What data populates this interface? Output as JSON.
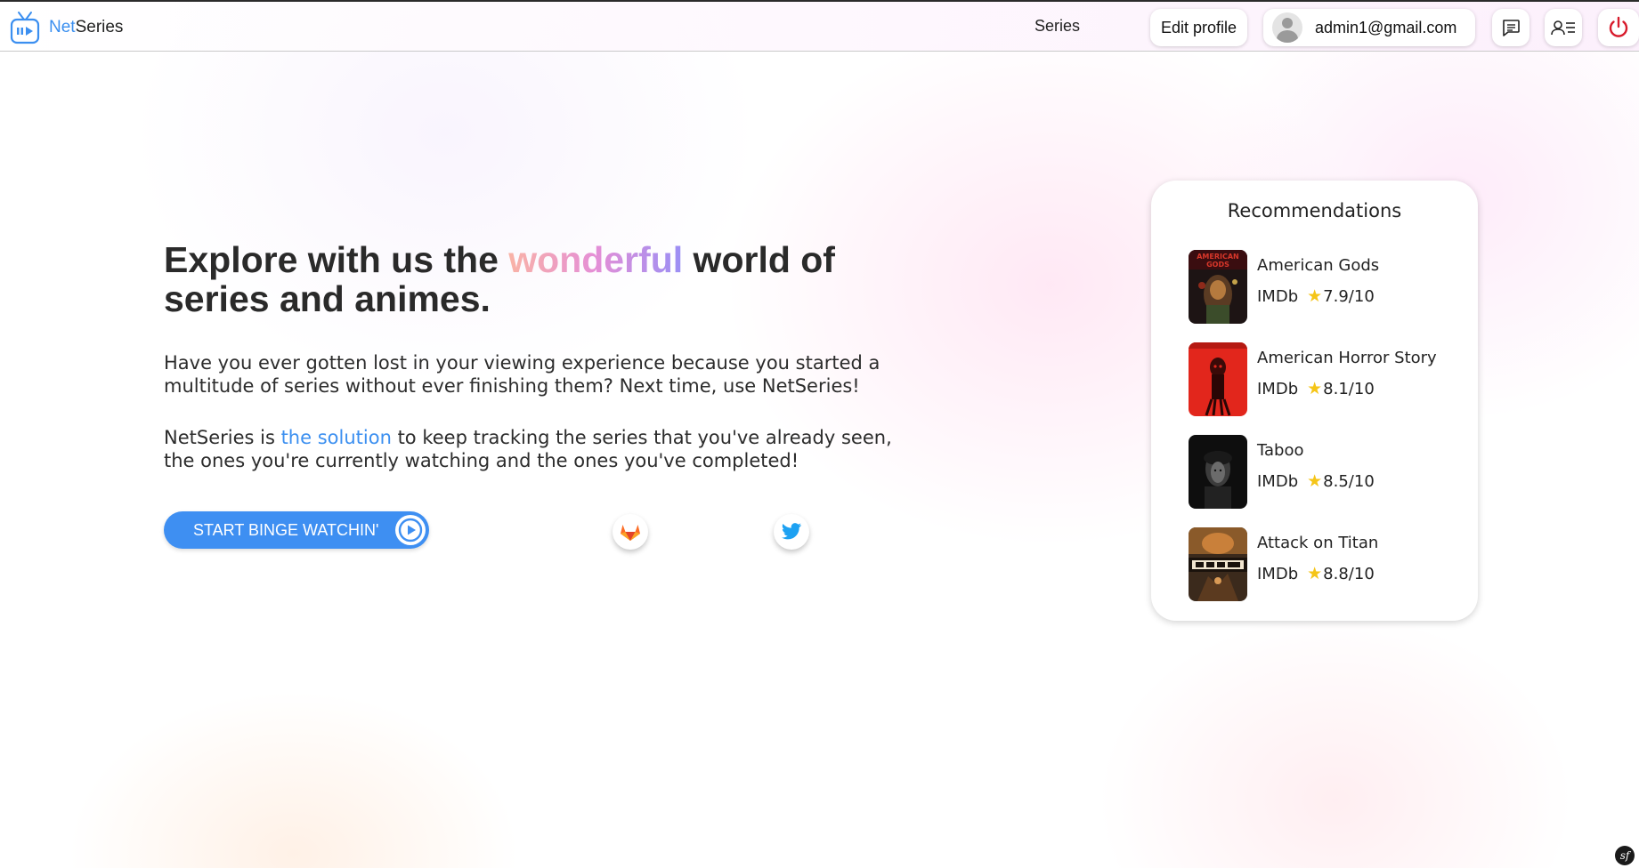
{
  "navbar": {
    "brand_prefix": "Net",
    "brand_suffix": "Series",
    "nav_series": "Series",
    "edit_profile": "Edit profile",
    "user_email": "admin1@gmail.com"
  },
  "hero": {
    "title_before": "Explore with us the ",
    "title_highlight": "wonderful",
    "title_after": " world of series and animes.",
    "paragraph1": "Have you ever gotten lost in your viewing experience because you started a multitude of series without ever finishing them? Next time, use NetSeries!",
    "paragraph2_before": "NetSeries is ",
    "paragraph2_highlight": "the solution",
    "paragraph2_after": " to keep tracking the series that you've already seen, the ones you're currently watching and the ones you've completed!",
    "cta_label": "START BINGE WATCHIN'"
  },
  "recommendations": {
    "title": "Recommendations",
    "items": [
      {
        "name": "American Gods",
        "source": "IMDb",
        "rating": "7.9/10"
      },
      {
        "name": "American Horror Story",
        "source": "IMDb",
        "rating": "8.1/10"
      },
      {
        "name": "Taboo",
        "source": "IMDb",
        "rating": "8.5/10"
      },
      {
        "name": "Attack on Titan",
        "source": "IMDb",
        "rating": "8.8/10"
      }
    ]
  },
  "colors": {
    "accent": "#3b8ff0",
    "power": "#d81b2c",
    "star": "#f5c518"
  },
  "icons": [
    "tv-icon",
    "message-icon",
    "contacts-icon",
    "power-icon",
    "play-circle-icon",
    "gitlab-icon",
    "twitter-icon",
    "star-icon",
    "symfony-icon"
  ]
}
